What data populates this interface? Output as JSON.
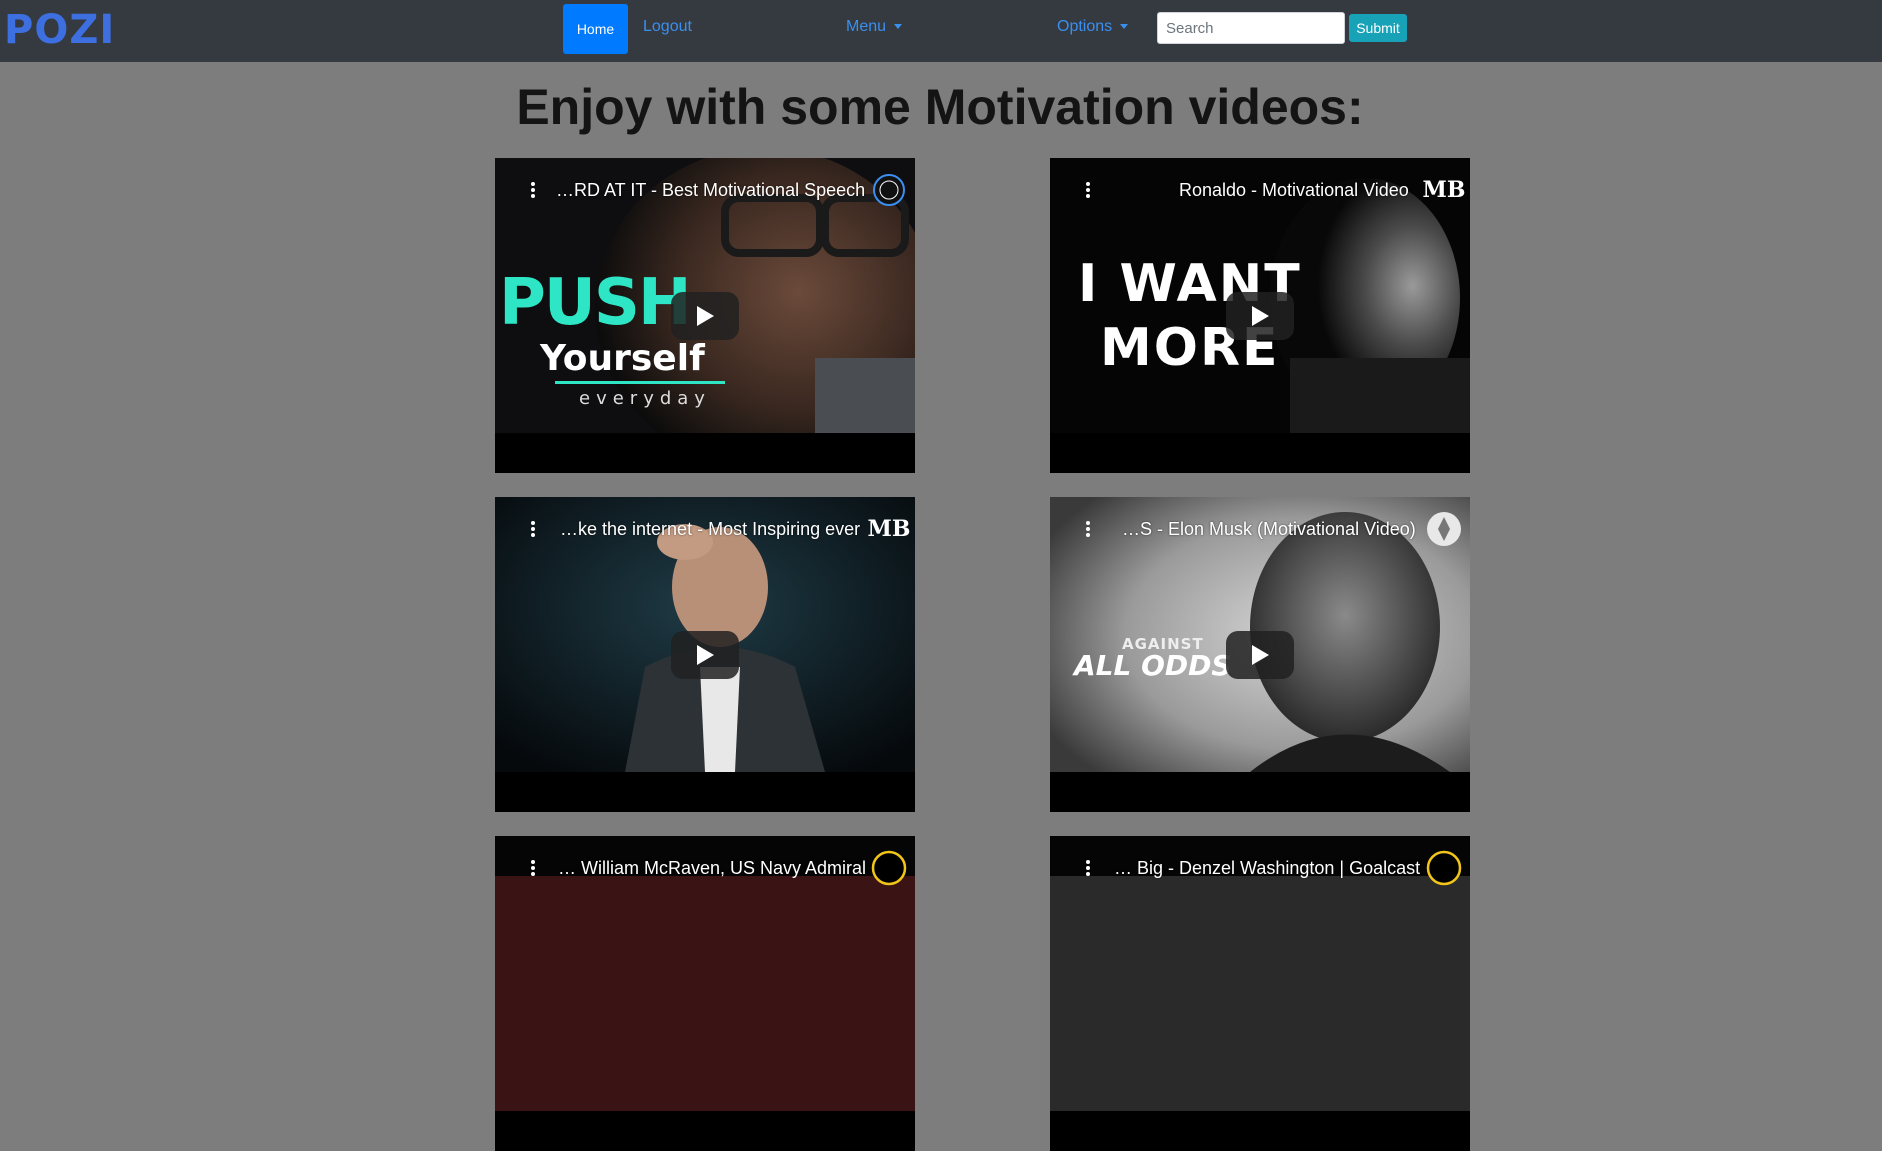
{
  "nav": {
    "brand": "POZI",
    "home": "Home",
    "logout": "Logout",
    "menu": "Menu",
    "options": "Options",
    "search_placeholder": "Search",
    "submit": "Submit"
  },
  "page": {
    "title": "Enjoy with some Motivation videos:"
  },
  "videos": [
    {
      "title": "…RD AT IT - Best Motivational Speech",
      "channel_logo": "law-of-attraction-logo",
      "overlay": {
        "line1": "PUSH",
        "line2": "Yourself",
        "line3": "everyday"
      }
    },
    {
      "title": "Ronaldo - Motivational Video",
      "channel_logo": "MB",
      "overlay": {
        "line1": "I WANT",
        "line2": "MORE"
      }
    },
    {
      "title": "…ke the internet - Most Inspiring ever",
      "channel_logo": "MB",
      "overlay": {}
    },
    {
      "title": "…S - Elon Musk (Motivational Video)",
      "channel_logo": "avatar-logo",
      "overlay": {
        "line1": "AGAINST",
        "line2": "ALL ODDS"
      }
    },
    {
      "title": "… William McRaven, US Navy Admiral",
      "channel_logo": "Goalcast",
      "overlay": {}
    },
    {
      "title": "… Big - Denzel Washington | Goalcast",
      "channel_logo": "Goalcast",
      "overlay": {}
    }
  ],
  "colors": {
    "navbar": "#343a40",
    "page_bg": "#7d7d7d",
    "primary": "#007bff",
    "info": "#17a2b8",
    "accent_teal": "#2ee6c5"
  }
}
